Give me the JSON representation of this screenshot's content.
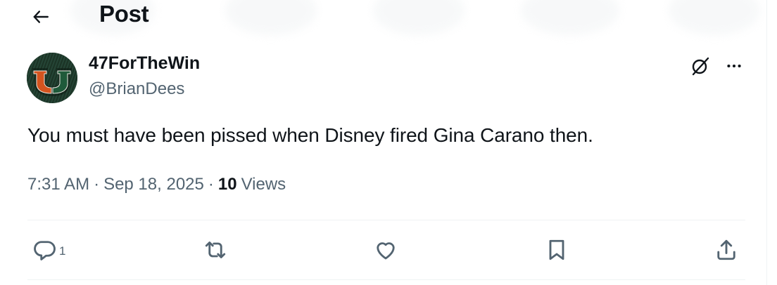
{
  "header": {
    "title": "Post"
  },
  "author": {
    "display_name": "47ForTheWin",
    "handle": "@BrianDees"
  },
  "tweet": {
    "text": "You must have been pissed when Disney fired Gina Carano then."
  },
  "meta": {
    "time": "7:31 AM",
    "separator": "·",
    "date": "Sep 18, 2025",
    "views_count": "10",
    "views_label": "Views"
  },
  "actions": {
    "reply_count": "1"
  },
  "icons": {
    "back": "arrow-left-icon",
    "grok": "grok-icon",
    "more": "more-horizontal-icon",
    "reply": "reply-icon",
    "repost": "repost-icon",
    "like": "heart-icon",
    "bookmark": "bookmark-icon",
    "share": "share-icon"
  },
  "colors": {
    "text": "#0f1419",
    "secondary": "#536471",
    "divider": "#eff3f4"
  }
}
